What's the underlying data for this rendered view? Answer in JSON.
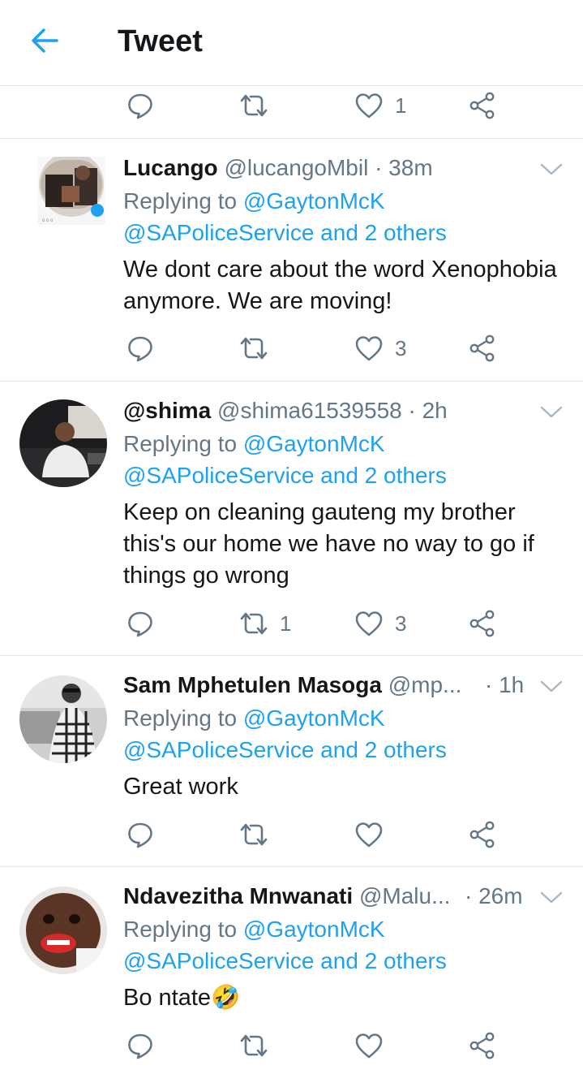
{
  "header": {
    "title": "Tweet",
    "back_icon": "arrow-left-icon"
  },
  "colors": {
    "accent": "#1da1f2",
    "muted": "#657786",
    "text": "#14171a",
    "border": "#e1e8ed"
  },
  "top_actions": {
    "reply_count": "",
    "retweet_count": "",
    "like_count": "1"
  },
  "tweets": [
    {
      "name": "Lucango",
      "handle": "@lucangoMbil",
      "time": "· 38m",
      "replying_prefix": "Replying to",
      "replying_user": "@GaytonMcK",
      "replying_more": "@SAPoliceService and 2 others",
      "text": "We dont care about the word Xenophobia anymore. We are moving!",
      "reply_count": "",
      "retweet_count": "",
      "like_count": "3"
    },
    {
      "name": "@shima",
      "handle": "@shima61539558",
      "time": "· 2h",
      "replying_prefix": "Replying to",
      "replying_user": "@GaytonMcK",
      "replying_more": "@SAPoliceService and 2 others",
      "text": "Keep on cleaning gauteng my brother this's our home we have no way to go if things go wrong",
      "reply_count": "",
      "retweet_count": "1",
      "like_count": "3"
    },
    {
      "name": "Sam Mphetulen Masoga",
      "handle": "@mp...",
      "time": "· 1h",
      "replying_prefix": "Replying to",
      "replying_user": "@GaytonMcK",
      "replying_more": "@SAPoliceService and 2 others",
      "text": "Great work",
      "reply_count": "",
      "retweet_count": "",
      "like_count": ""
    },
    {
      "name": "Ndavezitha Mnwanati",
      "handle": "@Malu...",
      "time": "· 26m",
      "replying_prefix": "Replying to",
      "replying_user": "@GaytonMcK",
      "replying_more": "@SAPoliceService and 2 others",
      "text": "Bo ntate🤣",
      "reply_count": "",
      "retweet_count": "",
      "like_count": ""
    }
  ]
}
